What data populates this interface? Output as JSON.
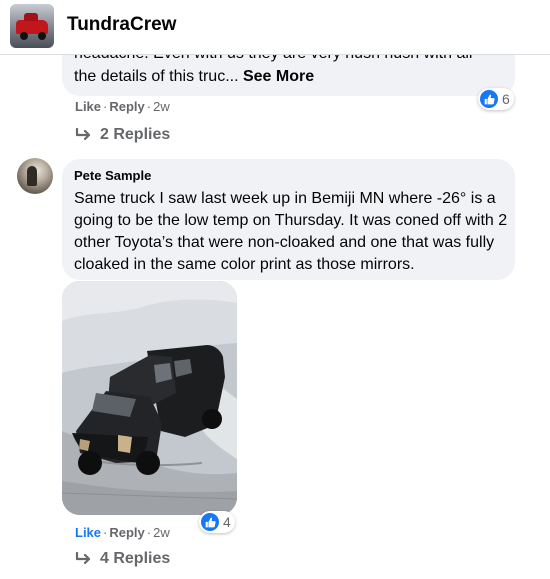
{
  "group": {
    "name": "TundraCrew"
  },
  "comment1": {
    "cut_line": "headache. Even with us they are very hush hush with all",
    "text": "the details of this truc... ",
    "see_more": "See More",
    "reaction_count": "6",
    "actions": {
      "like": "Like",
      "reply": "Reply",
      "time": "2w"
    },
    "replies_label": "2 Replies"
  },
  "comment2": {
    "author": "Pete Sample",
    "text": "Same truck I saw last week up in Bemiji MN where -26° is a going to be the low temp on Thursday. It was coned off with 2 other Toyota’s that were non-cloaked and one that was fully cloaked in the same color print as those mirrors.",
    "reaction_count": "4",
    "actions": {
      "like": "Like",
      "reply": "Reply",
      "time": "2w"
    },
    "replies_label": "4 Replies"
  },
  "colors": {
    "accent": "#1877f2",
    "secondary_text": "#65676b",
    "bubble": "#f0f2f5"
  },
  "icons": {
    "like_reaction": "thumbs-up-icon",
    "reply_arrow": "reply-arrow-icon"
  }
}
